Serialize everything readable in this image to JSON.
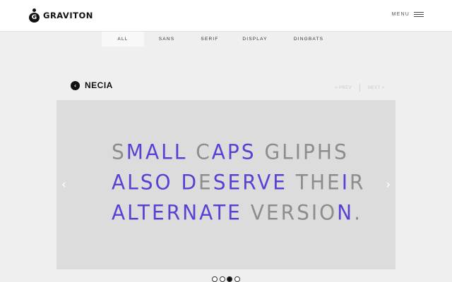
{
  "brand": {
    "name": "GRAVITON",
    "mark_letter": "G"
  },
  "menu": {
    "label": "MENU"
  },
  "tabs": [
    {
      "label": "ALL",
      "active": true
    },
    {
      "label": "SANS",
      "active": false
    },
    {
      "label": "SERIF",
      "active": false
    },
    {
      "label": "DISPLAY",
      "active": false
    },
    {
      "label": "DINGBATS",
      "active": false
    }
  ],
  "font": {
    "name": "NECIA",
    "back_glyph": "‹"
  },
  "pager": {
    "prev": "< PREV",
    "next": "NEXT >"
  },
  "slider": {
    "prev_glyph": "‹",
    "next_glyph": "›",
    "lines": [
      [
        {
          "t": "S",
          "accent": false
        },
        {
          "t": "MALL",
          "accent": true
        },
        {
          "t": " ",
          "accent": false
        },
        {
          "t": "C",
          "accent": false
        },
        {
          "t": "APS",
          "accent": true
        },
        {
          "t": " GLIPHS",
          "accent": false
        }
      ],
      [
        {
          "t": "ALSO",
          "accent": true
        },
        {
          "t": " ",
          "accent": false
        },
        {
          "t": "D",
          "accent": true
        },
        {
          "t": "E",
          "accent": false
        },
        {
          "t": "SERVE",
          "accent": true
        },
        {
          "t": " THE",
          "accent": false
        },
        {
          "t": "I",
          "accent": true
        },
        {
          "t": "R",
          "accent": false
        }
      ],
      [
        {
          "t": "ALTERNATE",
          "accent": true
        },
        {
          "t": " VERSIO",
          "accent": false
        },
        {
          "t": "N",
          "accent": true
        },
        {
          "t": ".",
          "accent": false
        }
      ]
    ],
    "dots": [
      false,
      false,
      true,
      false
    ]
  },
  "colors": {
    "accent": "#5b40d4",
    "muted_text": "#8d8d8d",
    "slide_bg": "#dcdcdc"
  },
  "icons": {
    "menu": "hamburger-icon",
    "back": "chevron-left-circle-icon",
    "slider_prev": "chevron-left-icon",
    "slider_next": "chevron-right-icon",
    "logo": "graviton-logo-icon"
  }
}
